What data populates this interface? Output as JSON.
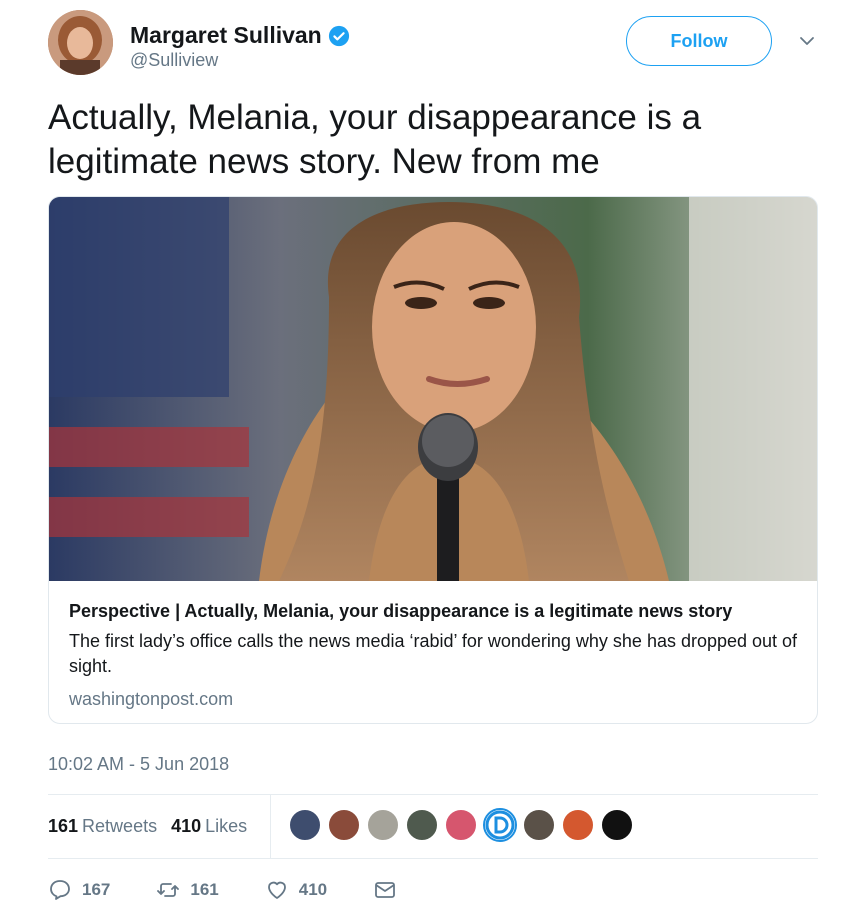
{
  "author": {
    "name": "Margaret Sullivan",
    "handle": "@Sulliview",
    "verified": true,
    "follow_label": "Follow"
  },
  "tweet": {
    "text": "Actually, Melania, your disappearance is a legitimate news story. New from me"
  },
  "card": {
    "title": "Perspective | Actually, Melania, your disappearance is a legitimate news story",
    "description": "The first lady’s office calls the news media ‘rabid’ for wondering why she has dropped out of sight.",
    "domain": "washingtonpost.com"
  },
  "timestamp": "10:02 AM - 5 Jun 2018",
  "stats": {
    "retweets_count": "161",
    "retweets_label": "Retweets",
    "likes_count": "410",
    "likes_label": "Likes"
  },
  "actions": {
    "reply_count": "167",
    "retweet_count": "161",
    "like_count": "410"
  },
  "colors": {
    "accent": "#1da1f2",
    "muted": "#657786",
    "text": "#14171a"
  }
}
